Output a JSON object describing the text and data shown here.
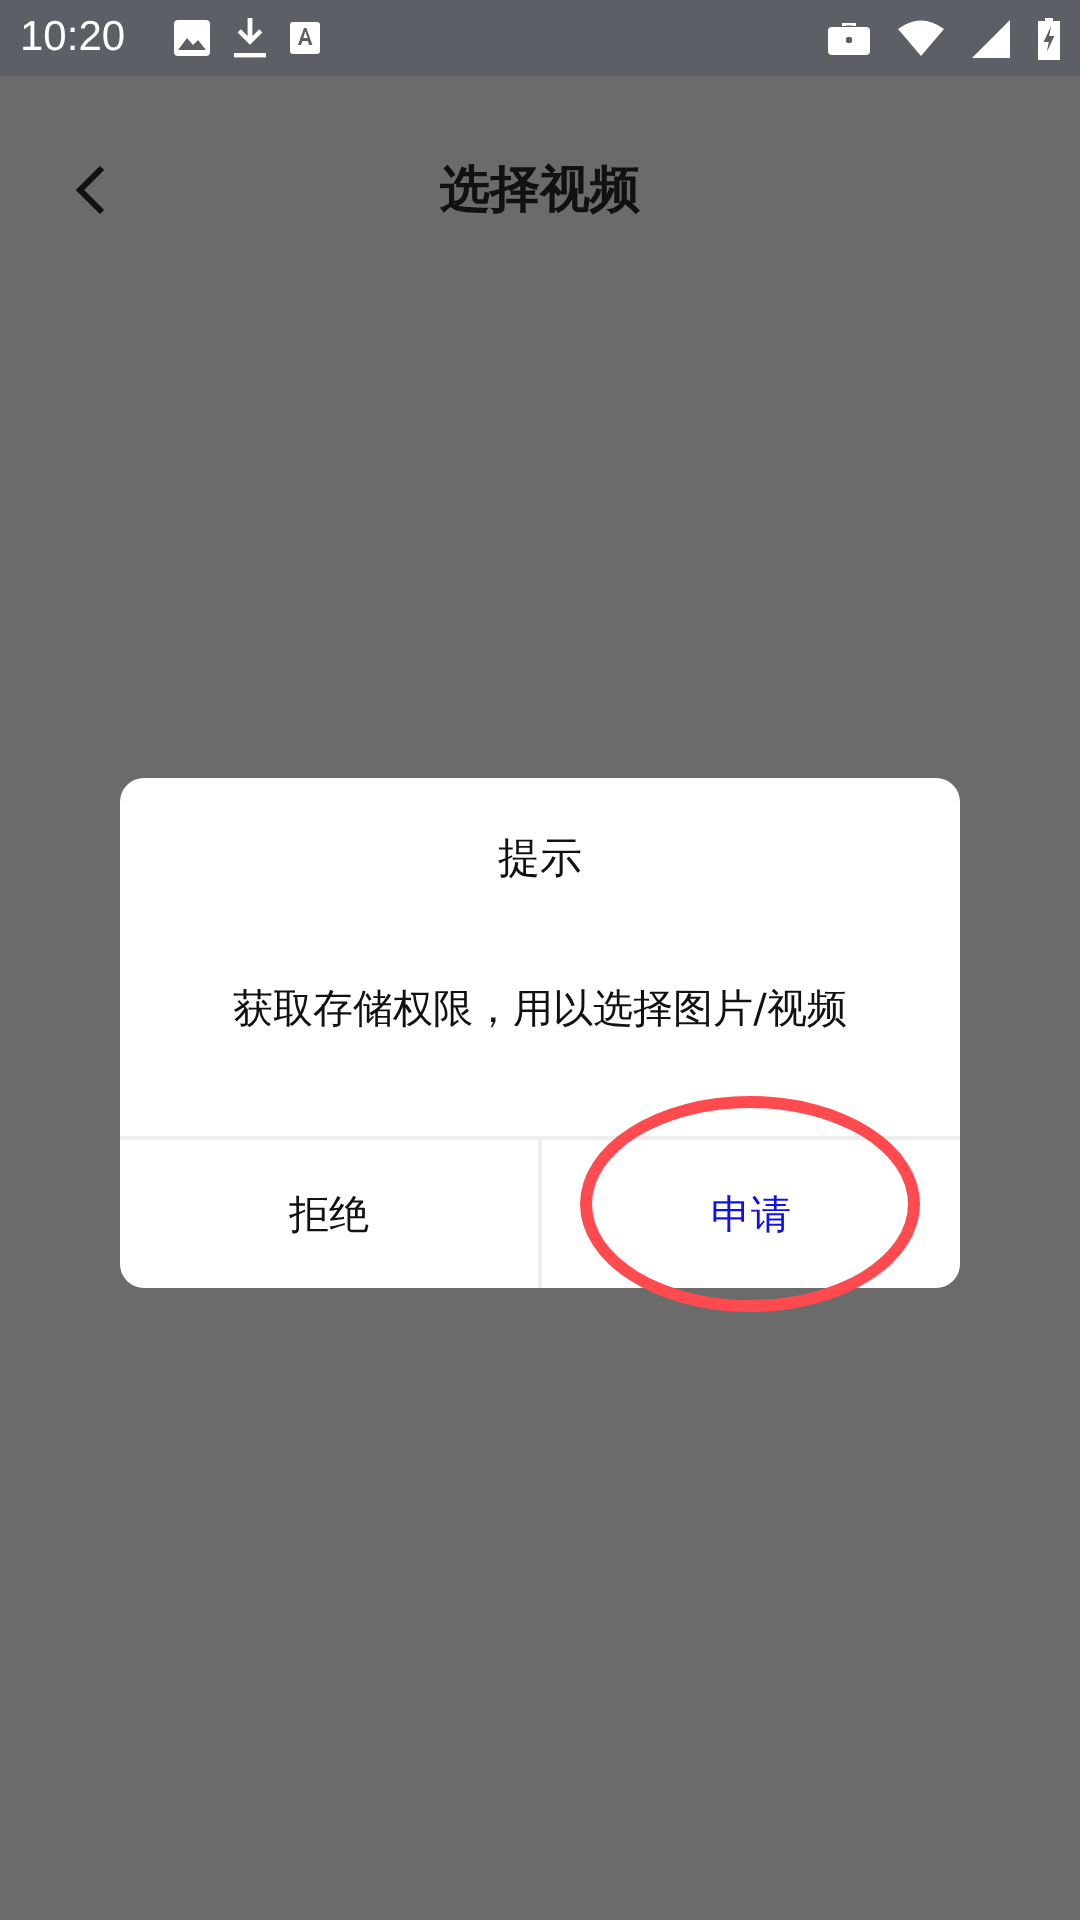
{
  "status_bar": {
    "time": "10:20"
  },
  "app_bar": {
    "title": "选择视频"
  },
  "dialog": {
    "title": "提示",
    "message": "获取存储权限，用以选择图片/视频",
    "buttons": [
      {
        "label": "拒绝",
        "primary": false,
        "highlighted": false
      },
      {
        "label": "申请",
        "primary": true,
        "highlighted": true
      }
    ]
  }
}
